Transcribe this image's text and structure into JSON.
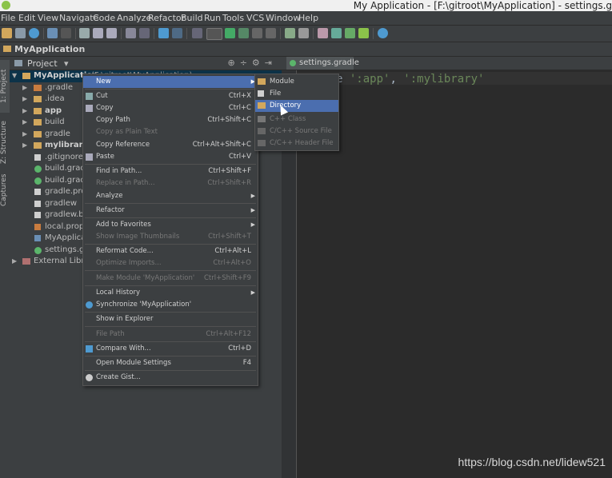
{
  "window": {
    "title": "My Application - [F:\\gitroot\\MyApplication] - settings.g"
  },
  "menubar": [
    "File",
    "Edit",
    "View",
    "Navigate",
    "Code",
    "Analyze",
    "Refactor",
    "Build",
    "Run",
    "Tools",
    "VCS",
    "Window",
    "Help"
  ],
  "navbar": {
    "project": "MyApplication"
  },
  "leftstrip": {
    "project_tab": "1: Project",
    "structure_tab": "Z: Structure",
    "captures_tab": "Captures"
  },
  "project_panel": {
    "view_label": "Project",
    "tree": [
      {
        "label": "MyApplication",
        "suffix": "(F:\\gitroot\\MyApplication)",
        "icon": "folder-icon",
        "expanded": true,
        "bold": true
      },
      {
        "label": ".gradle",
        "icon": "folder-icon"
      },
      {
        "label": ".idea",
        "icon": "folder-icon"
      },
      {
        "label": "app",
        "icon": "module-folder-icon",
        "bold": true
      },
      {
        "label": "build",
        "icon": "folder-icon"
      },
      {
        "label": "gradle",
        "icon": "folder-icon"
      },
      {
        "label": "mylibrary",
        "icon": "module-folder-icon",
        "bold": true
      },
      {
        "label": ".gitignore",
        "icon": "file-icon"
      },
      {
        "label": "build.gradle",
        "icon": "gradle-icon"
      },
      {
        "label": "build.gradle",
        "icon": "gradle-icon"
      },
      {
        "label": "gradle.prope",
        "icon": "file-icon"
      },
      {
        "label": "gradlew",
        "icon": "file-icon"
      },
      {
        "label": "gradlew.bat",
        "icon": "file-icon"
      },
      {
        "label": "local.proper",
        "icon": "file-icon"
      },
      {
        "label": "MyApplicati",
        "icon": "file-icon"
      },
      {
        "label": "settings.grac",
        "icon": "gradle-icon"
      },
      {
        "label": "External Librarie",
        "icon": "library-icon"
      }
    ]
  },
  "editor": {
    "tab": "settings.gradle",
    "code_prefix": "e ",
    "code_app": "':app'",
    "code_sep": ", ",
    "code_lib": "':mylibrary'"
  },
  "context_menu": {
    "items": [
      {
        "label": "New",
        "shortcut": "",
        "submenu": true,
        "highlight": true
      },
      {
        "label": "Cut",
        "shortcut": "Ctrl+X",
        "icon": "cut-icon"
      },
      {
        "label": "Copy",
        "shortcut": "Ctrl+C",
        "icon": "copy-icon"
      },
      {
        "label": "Copy Path",
        "shortcut": "Ctrl+Shift+C"
      },
      {
        "label": "Copy as Plain Text",
        "shortcut": "",
        "disabled": true
      },
      {
        "label": "Copy Reference",
        "shortcut": "Ctrl+Alt+Shift+C"
      },
      {
        "label": "Paste",
        "shortcut": "Ctrl+V",
        "icon": "paste-icon"
      },
      {
        "label": "Find in Path...",
        "shortcut": "Ctrl+Shift+F"
      },
      {
        "label": "Replace in Path...",
        "shortcut": "Ctrl+Shift+R",
        "disabled": true
      },
      {
        "label": "Analyze",
        "shortcut": "",
        "submenu": true
      },
      {
        "label": "Refactor",
        "shortcut": "",
        "submenu": true
      },
      {
        "label": "Add to Favorites",
        "shortcut": "",
        "submenu": true
      },
      {
        "label": "Show Image Thumbnails",
        "shortcut": "Ctrl+Shift+T",
        "disabled": true
      },
      {
        "label": "Reformat Code...",
        "shortcut": "Ctrl+Alt+L"
      },
      {
        "label": "Optimize Imports...",
        "shortcut": "Ctrl+Alt+O",
        "disabled": true
      },
      {
        "label": "Make Module 'MyApplication'",
        "shortcut": "Ctrl+Shift+F9",
        "disabled": true
      },
      {
        "label": "Local History",
        "shortcut": "",
        "submenu": true
      },
      {
        "label": "Synchronize 'MyApplication'",
        "shortcut": "",
        "icon": "sync-icon"
      },
      {
        "label": "Show in Explorer",
        "shortcut": ""
      },
      {
        "label": "File Path",
        "shortcut": "Ctrl+Alt+F12",
        "disabled": true
      },
      {
        "label": "Compare With...",
        "shortcut": "Ctrl+D",
        "icon": "compare-icon"
      },
      {
        "label": "Open Module Settings",
        "shortcut": "F4"
      },
      {
        "label": "Create Gist...",
        "shortcut": "",
        "icon": "github-icon"
      }
    ]
  },
  "new_submenu": {
    "items": [
      {
        "label": "Module",
        "icon": "module-icon"
      },
      {
        "label": "File",
        "icon": "file-icon"
      },
      {
        "label": "Directory",
        "icon": "folder-icon",
        "highlight": true
      },
      {
        "label": "C++ Class",
        "icon": "cpp-class-icon",
        "disabled": true
      },
      {
        "label": "C/C++ Source File",
        "icon": "cpp-source-icon",
        "disabled": true
      },
      {
        "label": "C/C++ Header File",
        "icon": "cpp-header-icon",
        "disabled": true
      }
    ]
  },
  "watermark": "https://blog.csdn.net/lidew521",
  "colors": {
    "selection": "#4b6eaf",
    "panel": "#3c3f41",
    "editor_bg": "#2b2b2b",
    "string": "#6a8759"
  }
}
